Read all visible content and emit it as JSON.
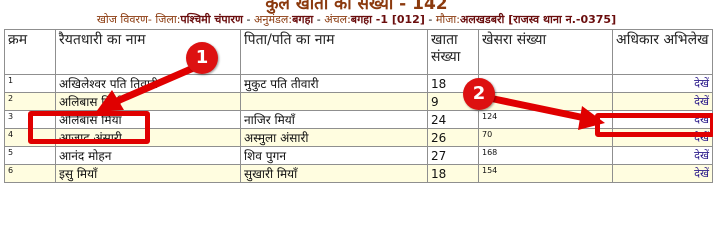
{
  "page": {
    "title": "कुल खाता का संख्या - 142",
    "search_details": {
      "label": "खोज विवरण-",
      "district_label": "जिला:",
      "district": "पश्चिमी चंपारण",
      "subdivision_label": "अनुमंडल:",
      "subdivision": "बगहा",
      "circle_label": "अंचल:",
      "circle": "बगहा -1 [012]",
      "mauza_label": "मौजा:",
      "mauza": "अलखडबरी [राजस्व थाना न.-0375]"
    }
  },
  "table": {
    "headers": {
      "serial": "क्रम",
      "raiyat": "रैयतधारी का नाम",
      "father": "पिता/पति का नाम",
      "khata": "खाता संख्या",
      "khesra": "खेसरा संख्या",
      "rights": "अधिकार अभिलेख"
    },
    "rows": [
      {
        "serial": "1",
        "raiyat": "अखिलेश्वर पति तिवारी",
        "father": "मुकुट पति तीवारी",
        "khata": "18",
        "khesra": "",
        "view": "देखें"
      },
      {
        "serial": "2",
        "raiyat": "अलिबास मियाँ",
        "father": "",
        "khata": "9",
        "khesra": "",
        "view": "देखें"
      },
      {
        "serial": "3",
        "raiyat": "अलिबास मियाँ",
        "father": "नाजिर मियाँ",
        "khata": "24",
        "khesra": "124",
        "view": "देखें"
      },
      {
        "serial": "4",
        "raiyat": "आजाद अंसारी",
        "father": "अस्मुला अंसारी",
        "khata": "26",
        "khesra": "70",
        "view": "देखें"
      },
      {
        "serial": "5",
        "raiyat": "आनंद मोहन",
        "father": "शिव पुगन",
        "khata": "27",
        "khesra": "168",
        "view": "देखें"
      },
      {
        "serial": "6",
        "raiyat": "इसु मियाँ",
        "father": "सुखारी मियाँ",
        "khata": "18",
        "khesra": "154",
        "view": "देखें"
      }
    ]
  },
  "annotations": {
    "badge1": "1",
    "badge2": "2",
    "color": "#e00000"
  }
}
